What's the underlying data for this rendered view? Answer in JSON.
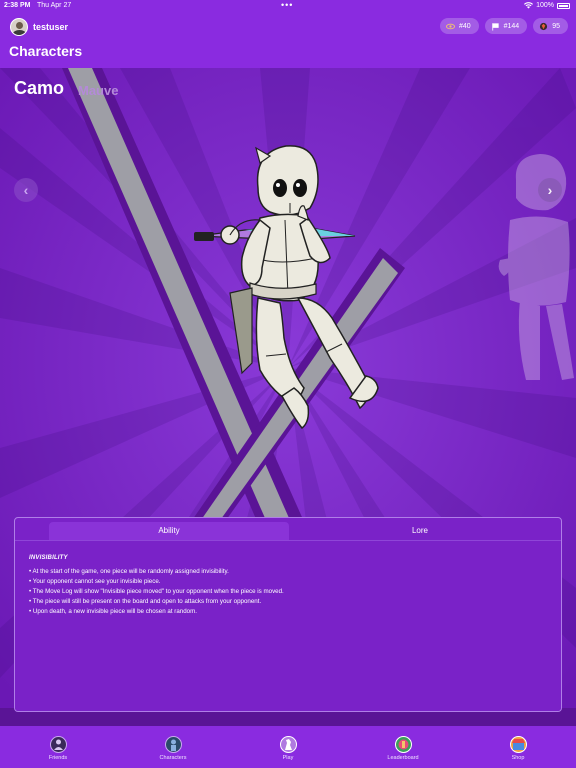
{
  "status": {
    "time": "2:38 PM",
    "date": "Thu Apr 27",
    "dots": "•••",
    "battery": "100%"
  },
  "header": {
    "username": "testuser",
    "title": "Characters",
    "pills": [
      {
        "icon": "eye-icon",
        "value": "#40"
      },
      {
        "icon": "flag-icon",
        "value": "#144"
      },
      {
        "icon": "coin-icon",
        "value": "95"
      }
    ]
  },
  "character": {
    "name": "Camo",
    "variant": "Mauve"
  },
  "panel": {
    "tabs": [
      {
        "label": "Ability",
        "active": true
      },
      {
        "label": "Lore",
        "active": false
      }
    ],
    "ability_title": "INVISIBILITY",
    "ability_lines": [
      "• At the start of the game, one piece will be randomly assigned invisibility.",
      "• Your opponent cannot see your invisible piece.",
      "• The Move Log will show \"Invisible piece moved\" to your opponent when the piece is moved.",
      "• The piece will still be present on the board and open to attacks from your opponent.",
      "• Upon death, a new invisible piece will be chosen at random."
    ]
  },
  "bottom_nav": [
    {
      "label": "Friends",
      "icon": "friends-icon"
    },
    {
      "label": "Characters",
      "icon": "characters-icon"
    },
    {
      "label": "Play",
      "icon": "play-icon"
    },
    {
      "label": "Leaderboard",
      "icon": "leaderboard-icon"
    },
    {
      "label": "Shop",
      "icon": "shop-icon"
    }
  ],
  "colors": {
    "header": "#8a2be0",
    "stage": "#7420c0",
    "accent": "#b07ee8"
  }
}
